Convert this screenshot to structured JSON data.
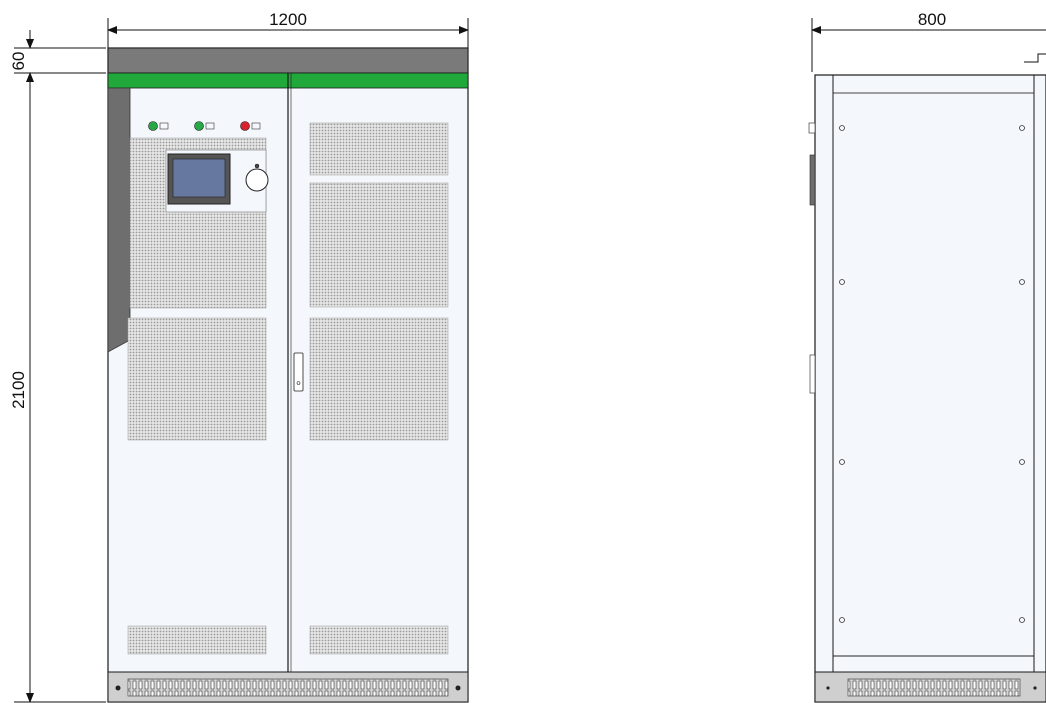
{
  "dimensions": {
    "front_width": "1200",
    "top_band_height": "60",
    "total_height": "2100",
    "side_depth": "800"
  },
  "colors": {
    "line": "#1a1a1a",
    "top_band": "#7a7a7a",
    "green_stripe": "#21a83a",
    "panel_fill": "#f4f7fb",
    "vent_mesh": "#bdbdbd",
    "side_bar": "#6e6e6e",
    "screen_frame": "#555555",
    "screen_glass": "#6677a0",
    "lamp_green": "#27a745",
    "lamp_red": "#d9232a",
    "bottom_plinth": "#cfcfcf"
  },
  "front_view": {
    "indicator_lamps": [
      {
        "id": "lamp-1",
        "color": "green"
      },
      {
        "id": "lamp-2",
        "color": "green"
      },
      {
        "id": "lamp-3",
        "color": "red"
      }
    ]
  }
}
